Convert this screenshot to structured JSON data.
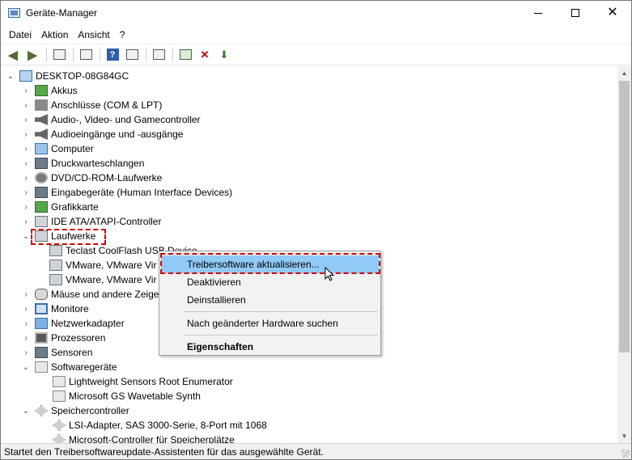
{
  "window": {
    "title": "Geräte-Manager"
  },
  "menubar": [
    "Datei",
    "Aktion",
    "Ansicht",
    "?"
  ],
  "tree": {
    "root": "DESKTOP-08G84GC",
    "items": [
      {
        "label": "Akkus",
        "icon": "battery-icon"
      },
      {
        "label": "Anschlüsse (COM & LPT)",
        "icon": "port-icon"
      },
      {
        "label": "Audio-, Video- und Gamecontroller",
        "icon": "speaker-icon"
      },
      {
        "label": "Audioeingänge und -ausgänge",
        "icon": "speaker-icon"
      },
      {
        "label": "Computer",
        "icon": "computer-icon"
      },
      {
        "label": "Druckwarteschlangen",
        "icon": "printer-icon"
      },
      {
        "label": "DVD/CD-ROM-Laufwerke",
        "icon": "disc-drive-icon"
      },
      {
        "label": "Eingabegeräte (Human Interface Devices)",
        "icon": "hid-icon"
      },
      {
        "label": "Grafikkarte",
        "icon": "display-adapter-icon"
      },
      {
        "label": "IDE ATA/ATAPI-Controller",
        "icon": "ide-controller-icon"
      },
      {
        "label": "Laufwerke",
        "icon": "disk-drive-icon",
        "expanded": true
      },
      {
        "label": "Teclast CoolFlash USB Device",
        "icon": "disk-drive-icon",
        "child": true
      },
      {
        "label": "VMware, VMware Vir",
        "icon": "disk-drive-icon",
        "child": true
      },
      {
        "label": "VMware, VMware Vir",
        "icon": "disk-drive-icon",
        "child": true
      },
      {
        "label": "Mäuse und andere Zeige",
        "icon": "mouse-icon"
      },
      {
        "label": "Monitore",
        "icon": "monitor-icon"
      },
      {
        "label": "Netzwerkadapter",
        "icon": "network-adapter-icon"
      },
      {
        "label": "Prozessoren",
        "icon": "processor-icon"
      },
      {
        "label": "Sensoren",
        "icon": "sensor-icon"
      },
      {
        "label": "Softwaregeräte",
        "icon": "software-device-icon",
        "expanded": true
      },
      {
        "label": "Lightweight Sensors Root Enumerator",
        "icon": "software-device-icon",
        "child": true
      },
      {
        "label": "Microsoft GS Wavetable Synth",
        "icon": "software-device-icon",
        "child": true
      },
      {
        "label": "Speichercontroller",
        "icon": "storage-controller-icon",
        "expanded": true
      },
      {
        "label": "LSI-Adapter, SAS 3000-Serie, 8-Port mit 1068",
        "icon": "storage-controller-icon",
        "child": true
      },
      {
        "label": "Microsoft-Controller für Speicherplätze",
        "icon": "storage-controller-icon",
        "child": true
      }
    ]
  },
  "context_menu": {
    "items": [
      {
        "label": "Treibersoftware aktualisieren...",
        "highlighted": true
      },
      {
        "label": "Deaktivieren"
      },
      {
        "label": "Deinstallieren"
      },
      {
        "label": "Nach geänderter Hardware suchen"
      },
      {
        "label": "Eigenschaften",
        "bold": true
      }
    ]
  },
  "statusbar": {
    "text": "Startet den Treibersoftwareupdate-Assistenten für das ausgewählte Gerät."
  },
  "colors": {
    "highlight": "#91c9f7",
    "annotation": "#d10000"
  }
}
